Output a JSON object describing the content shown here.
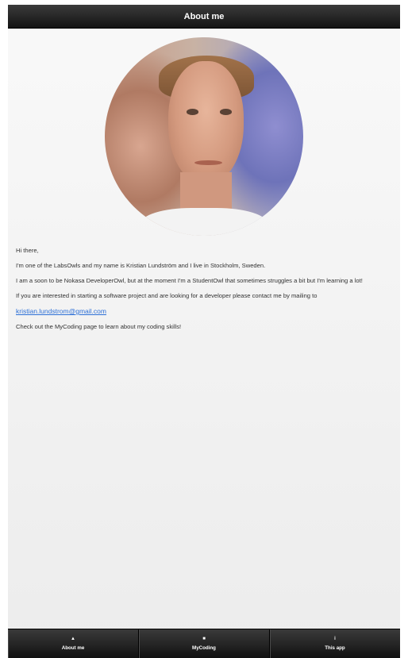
{
  "header": {
    "title": "About me"
  },
  "profile": {
    "photo_icon": "profile-photo"
  },
  "about": {
    "greeting": "Hi there,",
    "intro": "I'm one of the LabsOwls and my name is Kristian Lundström and I live in Stockholm, Sweden.",
    "status": "I am a soon to be Nokasa DeveloperOwl, but at the moment I'm a StudentOwl that sometimes struggles a bit but I'm learning a lot!",
    "contact_text": "If you are interested in starting a software project and are looking for a developer please contact me by mailing to",
    "email": "kristian.lundstrom@gmail.com",
    "coding_text": "Check out the MyCoding page to learn about my coding skills!"
  },
  "tabbar": {
    "items": [
      {
        "label": "About me",
        "icon": "up-arrow-icon",
        "glyph": "▲"
      },
      {
        "label": "MyCoding",
        "icon": "dot-icon",
        "glyph": "■"
      },
      {
        "label": "This app",
        "icon": "info-icon",
        "glyph": "i"
      }
    ]
  }
}
